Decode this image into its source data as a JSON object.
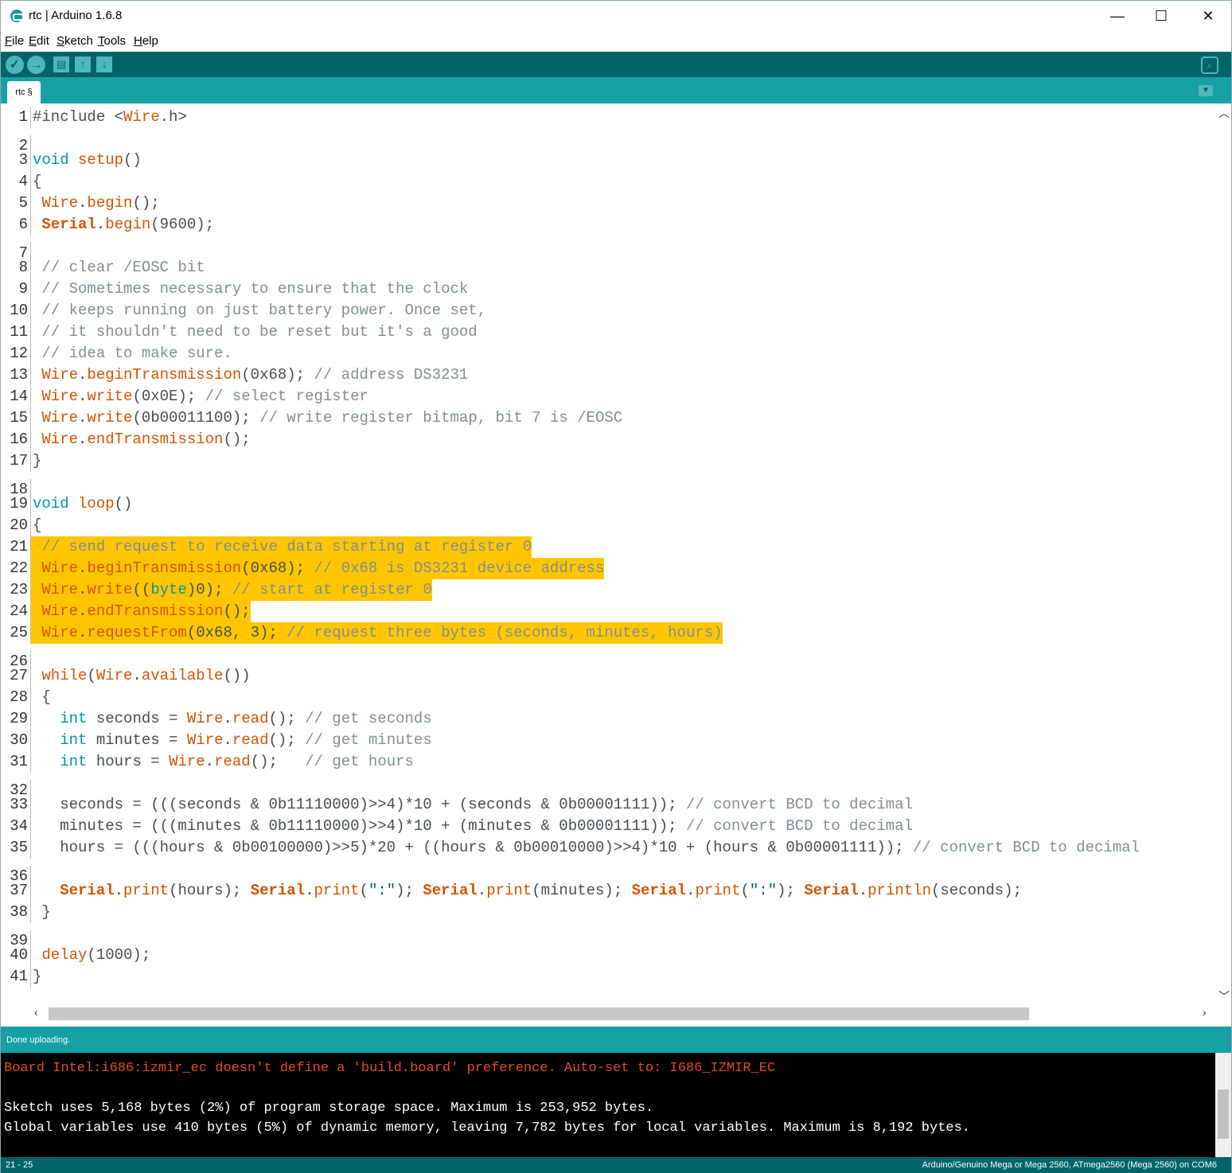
{
  "window": {
    "title": "rtc | Arduino 1.6.8",
    "minimize": "—",
    "maximize": "☐",
    "close": "✕"
  },
  "menu": [
    {
      "label": "File",
      "u": "F",
      "rest": "ile"
    },
    {
      "label": "Edit",
      "u": "E",
      "rest": "dit"
    },
    {
      "label": "Sketch",
      "u": "S",
      "rest": "ketch"
    },
    {
      "label": "Tools",
      "u": "T",
      "rest": "ools"
    },
    {
      "label": "Help",
      "u": "H",
      "rest": "elp"
    }
  ],
  "toolbar": {
    "verify": "✓",
    "upload": "→",
    "new": "▤",
    "open": "↑",
    "save": "↓",
    "serial_monitor": "⌕"
  },
  "tabs": [
    {
      "label": "rtc §"
    }
  ],
  "tab_menu": "▼",
  "editor": {
    "selection": "21 - 25",
    "lines": [
      {
        "n": "1",
        "tokens": [
          [
            "",
            "#include <"
          ],
          [
            "cls",
            "Wire"
          ],
          [
            "",
            ".h>"
          ]
        ]
      },
      {
        "n": "2",
        "tokens": []
      },
      {
        "n": "3",
        "tokens": [
          [
            "kw",
            "void"
          ],
          [
            "",
            " "
          ],
          [
            "cls",
            "setup"
          ],
          [
            "",
            "()"
          ]
        ]
      },
      {
        "n": "4",
        "tokens": [
          [
            "",
            "{"
          ]
        ]
      },
      {
        "n": "5",
        "tokens": [
          [
            "",
            " "
          ],
          [
            "cls",
            "Wire"
          ],
          [
            "",
            "."
          ],
          [
            "cls",
            "begin"
          ],
          [
            "",
            "();"
          ]
        ]
      },
      {
        "n": "6",
        "tokens": [
          [
            "",
            " "
          ],
          [
            "ser",
            "Serial"
          ],
          [
            "",
            "."
          ],
          [
            "cls",
            "begin"
          ],
          [
            "",
            "(9600);"
          ]
        ]
      },
      {
        "n": "7",
        "tokens": []
      },
      {
        "n": "8",
        "tokens": [
          [
            "",
            " "
          ],
          [
            "cmt",
            "// clear /EOSC bit"
          ]
        ]
      },
      {
        "n": "9",
        "tokens": [
          [
            "",
            " "
          ],
          [
            "cmt",
            "// Sometimes necessary to ensure that the clock"
          ]
        ]
      },
      {
        "n": "10",
        "tokens": [
          [
            "",
            " "
          ],
          [
            "cmt",
            "// keeps running on just battery power. Once set,"
          ]
        ]
      },
      {
        "n": "11",
        "tokens": [
          [
            "",
            " "
          ],
          [
            "cmt",
            "// it shouldn't need to be reset but it's a good"
          ]
        ]
      },
      {
        "n": "12",
        "tokens": [
          [
            "",
            " "
          ],
          [
            "cmt",
            "// idea to make sure."
          ]
        ]
      },
      {
        "n": "13",
        "tokens": [
          [
            "",
            " "
          ],
          [
            "cls",
            "Wire"
          ],
          [
            "",
            "."
          ],
          [
            "cls",
            "beginTransmission"
          ],
          [
            "",
            "(0x68); "
          ],
          [
            "cmt",
            "// address DS3231"
          ]
        ]
      },
      {
        "n": "14",
        "tokens": [
          [
            "",
            " "
          ],
          [
            "cls",
            "Wire"
          ],
          [
            "",
            "."
          ],
          [
            "cls",
            "write"
          ],
          [
            "",
            "(0x0E); "
          ],
          [
            "cmt",
            "// select register"
          ]
        ]
      },
      {
        "n": "15",
        "tokens": [
          [
            "",
            " "
          ],
          [
            "cls",
            "Wire"
          ],
          [
            "",
            "."
          ],
          [
            "cls",
            "write"
          ],
          [
            "",
            "(0b00011100); "
          ],
          [
            "cmt",
            "// write register bitmap, bit 7 is /EOSC"
          ]
        ]
      },
      {
        "n": "16",
        "tokens": [
          [
            "",
            " "
          ],
          [
            "cls",
            "Wire"
          ],
          [
            "",
            "."
          ],
          [
            "cls",
            "endTransmission"
          ],
          [
            "",
            "();"
          ]
        ]
      },
      {
        "n": "17",
        "tokens": [
          [
            "",
            "}"
          ]
        ]
      },
      {
        "n": "18",
        "tokens": []
      },
      {
        "n": "19",
        "tokens": [
          [
            "kw",
            "void"
          ],
          [
            "",
            " "
          ],
          [
            "cls",
            "loop"
          ],
          [
            "",
            "()"
          ]
        ]
      },
      {
        "n": "20",
        "tokens": [
          [
            "",
            "{"
          ]
        ]
      },
      {
        "n": "21",
        "hl": true,
        "tokens": [
          [
            "",
            " "
          ],
          [
            "cmt",
            "// send request to receive data starting at register 0"
          ]
        ]
      },
      {
        "n": "22",
        "hl": true,
        "tokens": [
          [
            "",
            " "
          ],
          [
            "cls",
            "Wire"
          ],
          [
            "",
            "."
          ],
          [
            "cls",
            "beginTransmission"
          ],
          [
            "",
            "(0x68); "
          ],
          [
            "cmt",
            "// 0x68 is DS3231 device address"
          ]
        ]
      },
      {
        "n": "23",
        "hl": true,
        "tokens": [
          [
            "",
            " "
          ],
          [
            "cls",
            "Wire"
          ],
          [
            "",
            "."
          ],
          [
            "cls",
            "write"
          ],
          [
            "",
            "(("
          ],
          [
            "kw",
            "byte"
          ],
          [
            "",
            ")0); "
          ],
          [
            "cmt",
            "// start at register 0"
          ]
        ]
      },
      {
        "n": "24",
        "hl": true,
        "tokens": [
          [
            "",
            " "
          ],
          [
            "cls",
            "Wire"
          ],
          [
            "",
            "."
          ],
          [
            "cls",
            "endTransmission"
          ],
          [
            "",
            "();"
          ]
        ]
      },
      {
        "n": "25",
        "hl": true,
        "tokens": [
          [
            "",
            " "
          ],
          [
            "cls",
            "Wire"
          ],
          [
            "",
            "."
          ],
          [
            "cls",
            "requestFrom"
          ],
          [
            "",
            "(0x68, 3); "
          ],
          [
            "cmt",
            "// request three bytes (seconds, minutes, hours)"
          ]
        ]
      },
      {
        "n": "26",
        "tokens": []
      },
      {
        "n": "27",
        "tokens": [
          [
            "",
            " "
          ],
          [
            "cls",
            "while"
          ],
          [
            "",
            "("
          ],
          [
            "cls",
            "Wire"
          ],
          [
            "",
            "."
          ],
          [
            "cls",
            "available"
          ],
          [
            "",
            "())"
          ]
        ]
      },
      {
        "n": "28",
        "tokens": [
          [
            "",
            " {"
          ]
        ]
      },
      {
        "n": "29",
        "tokens": [
          [
            "",
            "   "
          ],
          [
            "kw",
            "int"
          ],
          [
            "",
            " seconds = "
          ],
          [
            "cls",
            "Wire"
          ],
          [
            "",
            "."
          ],
          [
            "cls",
            "read"
          ],
          [
            "",
            "(); "
          ],
          [
            "cmt",
            "// get seconds"
          ]
        ]
      },
      {
        "n": "30",
        "tokens": [
          [
            "",
            "   "
          ],
          [
            "kw",
            "int"
          ],
          [
            "",
            " minutes = "
          ],
          [
            "cls",
            "Wire"
          ],
          [
            "",
            "."
          ],
          [
            "cls",
            "read"
          ],
          [
            "",
            "(); "
          ],
          [
            "cmt",
            "// get minutes"
          ]
        ]
      },
      {
        "n": "31",
        "tokens": [
          [
            "",
            "   "
          ],
          [
            "kw",
            "int"
          ],
          [
            "",
            " hours = "
          ],
          [
            "cls",
            "Wire"
          ],
          [
            "",
            "."
          ],
          [
            "cls",
            "read"
          ],
          [
            "",
            "();   "
          ],
          [
            "cmt",
            "// get hours"
          ]
        ]
      },
      {
        "n": "32",
        "tokens": []
      },
      {
        "n": "33",
        "tokens": [
          [
            "",
            "   seconds = (((seconds & 0b11110000)>>4)*10 + (seconds & 0b00001111)); "
          ],
          [
            "cmt",
            "// convert BCD to decimal"
          ]
        ]
      },
      {
        "n": "34",
        "tokens": [
          [
            "",
            "   minutes = (((minutes & 0b11110000)>>4)*10 + (minutes & 0b00001111)); "
          ],
          [
            "cmt",
            "// convert BCD to decimal"
          ]
        ]
      },
      {
        "n": "35",
        "tokens": [
          [
            "",
            "   hours = (((hours & 0b00100000)>>5)*20 + ((hours & 0b00010000)>>4)*10 + (hours & 0b00001111)); "
          ],
          [
            "cmt",
            "// convert BCD to decimal"
          ]
        ]
      },
      {
        "n": "36",
        "tokens": []
      },
      {
        "n": "37",
        "tokens": [
          [
            "",
            "   "
          ],
          [
            "ser",
            "Serial"
          ],
          [
            "",
            "."
          ],
          [
            "cls",
            "print"
          ],
          [
            "",
            "(hours); "
          ],
          [
            "ser",
            "Serial"
          ],
          [
            "",
            "."
          ],
          [
            "cls",
            "print"
          ],
          [
            "",
            "("
          ],
          [
            "str",
            "\":\""
          ],
          [
            "",
            "); "
          ],
          [
            "ser",
            "Serial"
          ],
          [
            "",
            "."
          ],
          [
            "cls",
            "print"
          ],
          [
            "",
            "(minutes); "
          ],
          [
            "ser",
            "Serial"
          ],
          [
            "",
            "."
          ],
          [
            "cls",
            "print"
          ],
          [
            "",
            "("
          ],
          [
            "str",
            "\":\""
          ],
          [
            "",
            "); "
          ],
          [
            "ser",
            "Serial"
          ],
          [
            "",
            "."
          ],
          [
            "cls",
            "println"
          ],
          [
            "",
            "(seconds);"
          ]
        ]
      },
      {
        "n": "38",
        "tokens": [
          [
            "",
            " }"
          ]
        ]
      },
      {
        "n": "39",
        "tokens": []
      },
      {
        "n": "40",
        "tokens": [
          [
            "",
            " "
          ],
          [
            "cls",
            "delay"
          ],
          [
            "",
            "(1000);"
          ]
        ]
      },
      {
        "n": "41",
        "tokens": [
          [
            "",
            "}"
          ]
        ]
      }
    ]
  },
  "status": {
    "message": "Done uploading."
  },
  "console": {
    "lines": [
      {
        "text": "Board Intel:i686:izmir_ec doesn't define a 'build.board' preference. Auto-set to: I686_IZMIR_EC",
        "color": "#e34c22"
      },
      {
        "text": "",
        "color": "#ffffff"
      },
      {
        "text": "Sketch uses 5,168 bytes (2%) of program storage space. Maximum is 253,952 bytes.",
        "color": "#ffffff"
      },
      {
        "text": "Global variables use 410 bytes (5%) of dynamic memory, leaving 7,782 bytes for local variables. Maximum is 8,192 bytes.",
        "color": "#ffffff"
      }
    ]
  },
  "footer": {
    "line_info": "21 - 25",
    "board": "Arduino/Genuino Mega or Mega 2560, ATmega2560 (Mega 2560) on COM6"
  },
  "colors": {
    "teal_dark": "#006468",
    "teal": "#17a1a5",
    "highlight": "#ffc600",
    "keyword": "#00979c",
    "function": "#d35400",
    "comment": "#7e8f95"
  }
}
